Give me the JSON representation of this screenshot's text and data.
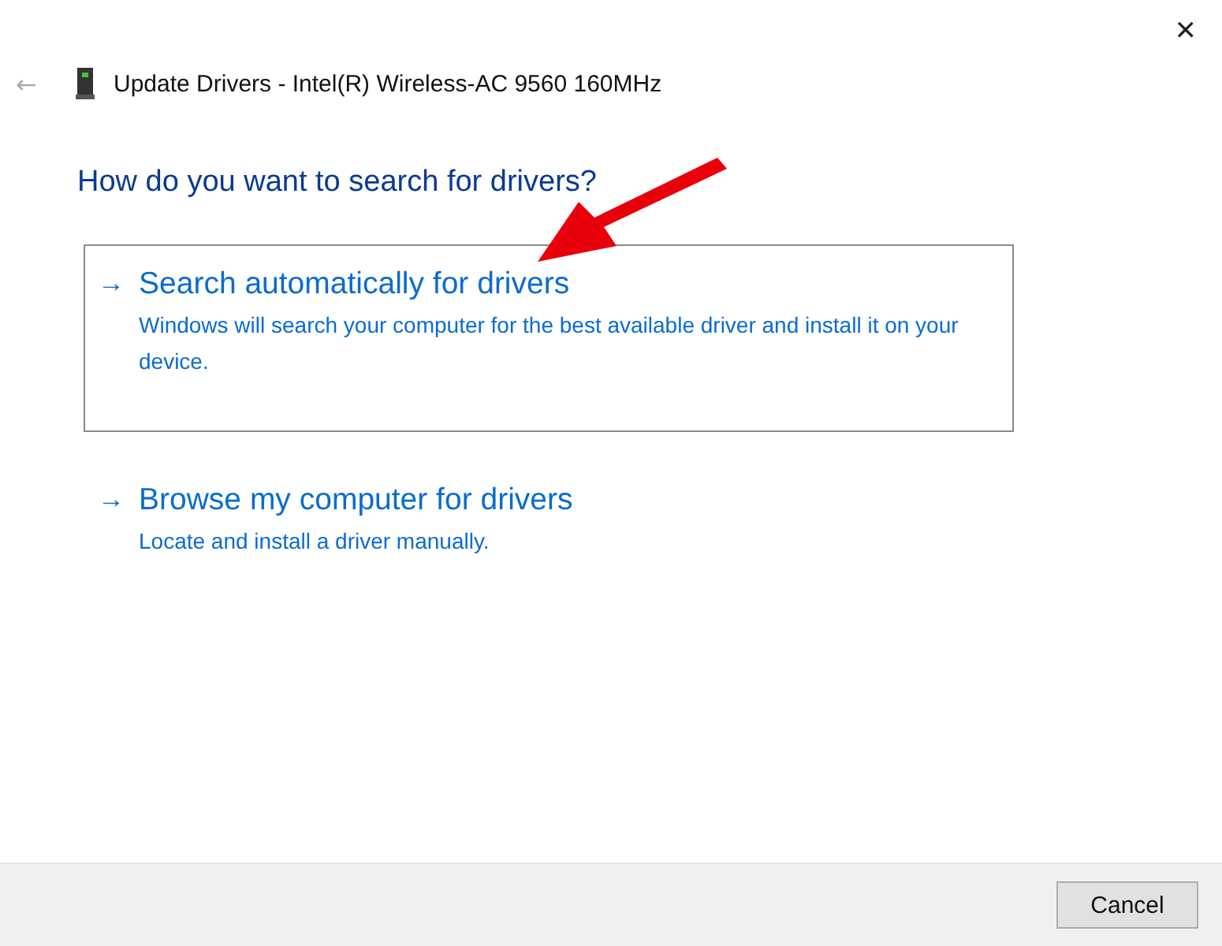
{
  "window": {
    "title": "Update Drivers - Intel(R) Wireless-AC 9560 160MHz",
    "close": "✕",
    "back": "←"
  },
  "heading": "How do you want to search for drivers?",
  "options": [
    {
      "arrow": "→",
      "title": "Search automatically for drivers",
      "description": "Windows will search your computer for the best available driver and install it on your device.",
      "selected": true
    },
    {
      "arrow": "→",
      "title": "Browse my computer for drivers",
      "description": "Locate and install a driver manually.",
      "selected": false
    }
  ],
  "buttons": [
    "Cancel"
  ]
}
